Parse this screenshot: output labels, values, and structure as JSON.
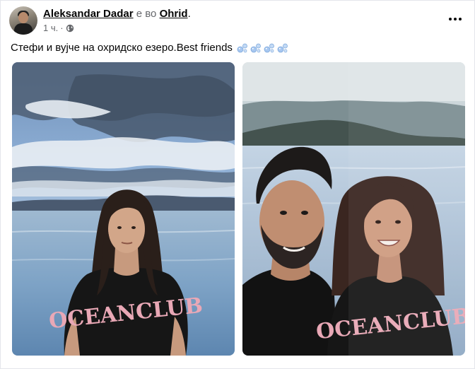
{
  "post": {
    "author": "Aleksandar Dadar",
    "location_connector": "е во",
    "location": "Ohrid",
    "location_suffix": ".",
    "time": "1 ч.",
    "time_separator": "·",
    "caption": "Стефи и вујче на охридско езеро.Best friends",
    "caption_emojis": [
      "bubbles-emoji",
      "bubbles-emoji",
      "bubbles-emoji",
      "bubbles-emoji"
    ],
    "audience_icon": "globe-icon",
    "menu_icon": "more-horizontal-icon",
    "photos": [
      {
        "name": "photo-girl-by-lake",
        "subject": "girl in black t-shirt in front of lake under cloudy sky"
      },
      {
        "name": "photo-selfie-uncle-niece",
        "subject": "man and girl selfie at lake shore"
      }
    ]
  },
  "colors": {
    "text_primary": "#050505",
    "text_secondary": "#65676b",
    "border": "#e4e6eb",
    "bubble": "#a7c7f0"
  }
}
